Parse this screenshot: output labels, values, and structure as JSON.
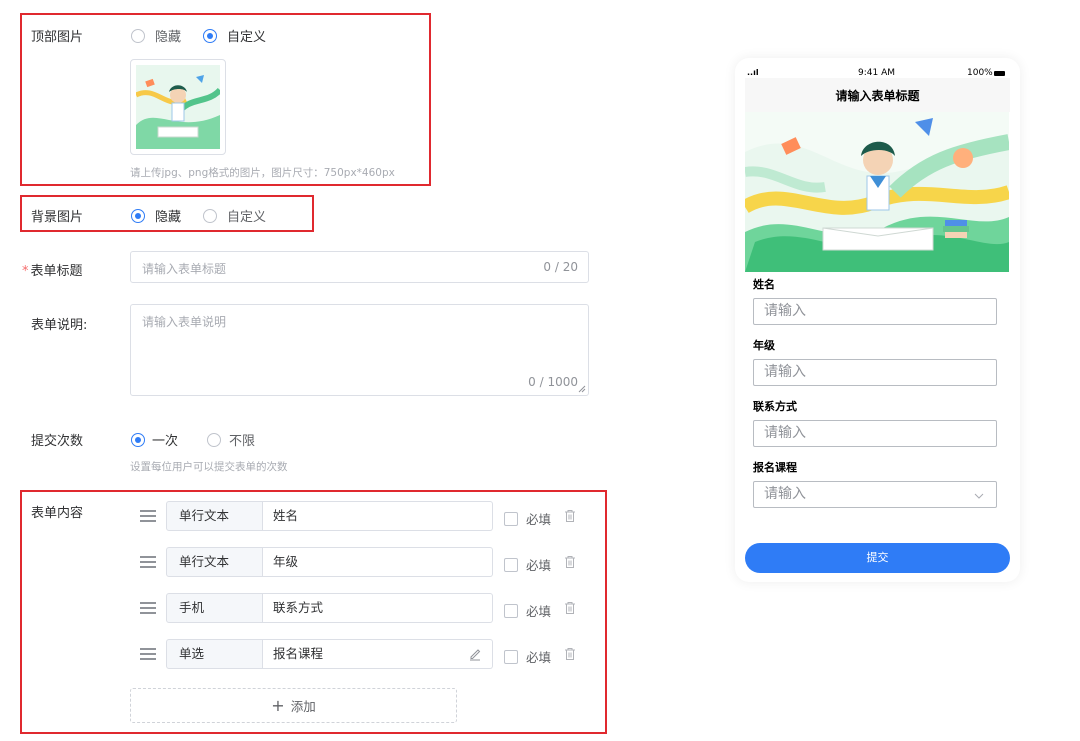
{
  "form": {
    "top_image": {
      "label": "顶部图片",
      "options": [
        "隐藏",
        "自定义"
      ],
      "selected": "自定义",
      "hint": "请上传jpg、png格式的图片，图片尺寸：750px*460px"
    },
    "bg_image": {
      "label": "背景图片",
      "options": [
        "隐藏",
        "自定义"
      ],
      "selected": "隐藏"
    },
    "title_field": {
      "required_mark": "*",
      "label": "表单标题",
      "placeholder": "请输入表单标题",
      "counter": "0 / 20"
    },
    "desc_field": {
      "label": "表单说明:",
      "placeholder": "请输入表单说明",
      "counter": "0 / 1000"
    },
    "submit_count": {
      "label": "提交次数",
      "options": [
        "一次",
        "不限"
      ],
      "selected": "一次",
      "hint": "设置每位用户可以提交表单的次数"
    },
    "content": {
      "label": "表单内容",
      "rows": [
        {
          "type": "单行文本",
          "name": "姓名",
          "required_label": "必填",
          "editable": false
        },
        {
          "type": "单行文本",
          "name": "年级",
          "required_label": "必填",
          "editable": false
        },
        {
          "type": "手机",
          "name": "联系方式",
          "required_label": "必填",
          "editable": false
        },
        {
          "type": "单选",
          "name": "报名课程",
          "required_label": "必填",
          "editable": true
        }
      ],
      "add_label": "添加",
      "add_icon": "+"
    }
  },
  "preview": {
    "status": {
      "signal": "..ıl",
      "time": "9:41 AM",
      "battery": "100%"
    },
    "title": "请输入表单标题",
    "fields": [
      {
        "label": "姓名",
        "placeholder": "请输入",
        "dropdown": false
      },
      {
        "label": "年级",
        "placeholder": "请输入",
        "dropdown": false
      },
      {
        "label": "联系方式",
        "placeholder": "请输入",
        "dropdown": false
      },
      {
        "label": "报名课程",
        "placeholder": "请输入",
        "dropdown": true
      }
    ],
    "submit_label": "提交"
  },
  "colors": {
    "accent": "#2f7cf6",
    "highlight_border": "#e0292f"
  }
}
